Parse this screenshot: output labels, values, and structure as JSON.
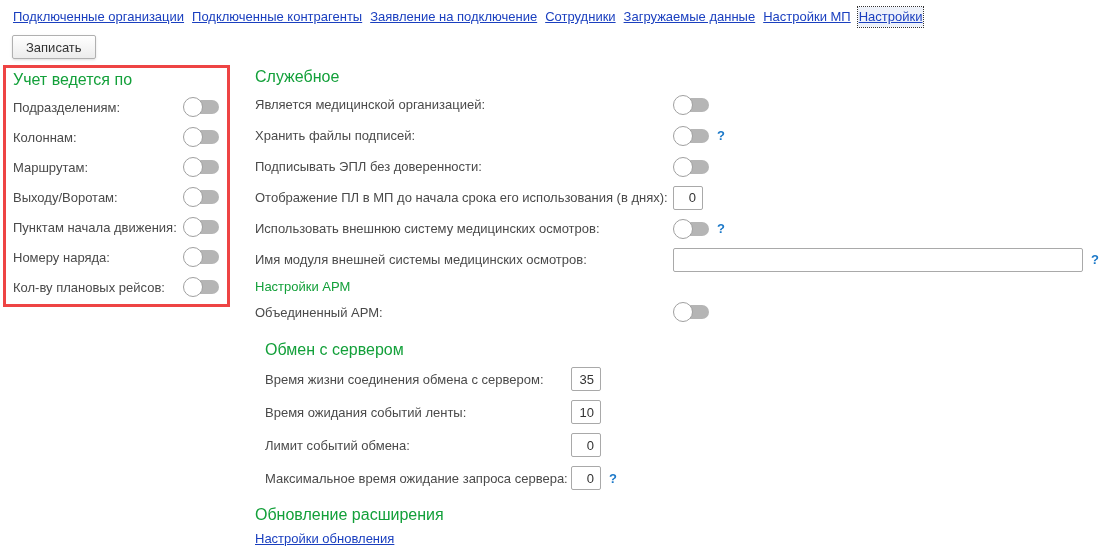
{
  "nav": [
    {
      "label": "Подключенные организации",
      "selected": false
    },
    {
      "label": "Подключенные контрагенты",
      "selected": false
    },
    {
      "label": "Заявление на подключение",
      "selected": false
    },
    {
      "label": "Сотрудники",
      "selected": false
    },
    {
      "label": "Загружаемые данные",
      "selected": false
    },
    {
      "label": "Настройки МП",
      "selected": false
    },
    {
      "label": "Настройки",
      "selected": true
    }
  ],
  "save_button": "Записать",
  "accounting": {
    "title": "Учет ведется по",
    "rows": [
      {
        "label": "Подразделениям:",
        "kind": "toggle",
        "on": false
      },
      {
        "label": "Колоннам:",
        "kind": "toggle",
        "on": false
      },
      {
        "label": "Маршрутам:",
        "kind": "toggle",
        "on": false
      },
      {
        "label": "Выходу/Воротам:",
        "kind": "toggle",
        "on": false
      },
      {
        "label": "Пунктам начала движения:",
        "kind": "toggle",
        "on": false
      },
      {
        "label": "Номеру наряда:",
        "kind": "toggle",
        "on": false
      },
      {
        "label": "Кол-ву плановых рейсов:",
        "kind": "toggle",
        "on": false
      }
    ]
  },
  "service": {
    "title": "Служебное",
    "rows": [
      {
        "label": "Является медицинской организацией:",
        "kind": "toggle",
        "on": false
      },
      {
        "label": "Хранить файлы подписей:",
        "kind": "toggle",
        "on": false,
        "help": "?"
      },
      {
        "label": "Подписывать ЭПЛ без доверенности:",
        "kind": "toggle",
        "on": false
      },
      {
        "label": "Отображение ПЛ в МП до начала срока его использования (в днях):",
        "kind": "number",
        "value": "0"
      },
      {
        "label": "Использовать внешнюю систему медицинских осмотров:",
        "kind": "toggle",
        "on": false,
        "help": "?"
      },
      {
        "label": "Имя модуля внешней системы медицинских осмотров:",
        "kind": "text",
        "help": "?"
      }
    ]
  },
  "arm": {
    "title": "Настройки АРМ",
    "rows": [
      {
        "label": "Объединенный АРМ:",
        "kind": "toggle",
        "on": false
      }
    ]
  },
  "exchange": {
    "title": "Обмен с сервером",
    "rows": [
      {
        "label": "Время жизни соединения обмена с сервером:",
        "kind": "number",
        "value": "35"
      },
      {
        "label": "Время ожидания событий ленты:",
        "kind": "number",
        "value": "10"
      },
      {
        "label": "Лимит событий обмена:",
        "kind": "number",
        "value": "0"
      },
      {
        "label": "Максимальное время ожидание запроса сервера:",
        "kind": "number",
        "value": "0",
        "help": "?"
      }
    ]
  },
  "update": {
    "title": "Обновление расширения",
    "link": "Настройки обновления"
  }
}
